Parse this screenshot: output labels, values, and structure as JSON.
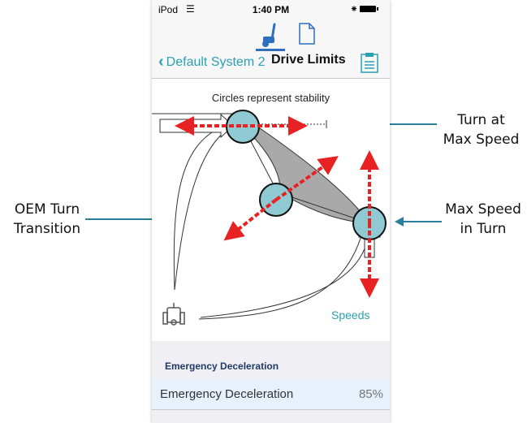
{
  "annotations": {
    "turn_at_max_speed": "Turn at\nMax Speed",
    "oem_turn_transition": "OEM Turn\nTransition",
    "max_speed_in_turn": "Max Speed\nin Turn"
  },
  "status_bar": {
    "device": "iPod",
    "time": "1:40 PM"
  },
  "tabs": [
    {
      "icon": "wheelchair-drive-icon",
      "selected": true
    },
    {
      "icon": "document-icon",
      "selected": false
    }
  ],
  "nav": {
    "back_label": "Default System 2",
    "title": "Drive Limits"
  },
  "plot": {
    "caption": "Circles represent stability",
    "speeds_label": "Speeds"
  },
  "section": {
    "header": "Emergency Deceleration",
    "rows": [
      {
        "label": "Emergency Deceleration",
        "value": "85%"
      }
    ]
  },
  "colors": {
    "accent": "#2aa0b5",
    "callout": "#2a7f9a",
    "arrow": "#e82222",
    "circle_fill": "#8fcad3",
    "section_header_text": "#1f3a66",
    "selected_row": "#e7f1fb"
  }
}
